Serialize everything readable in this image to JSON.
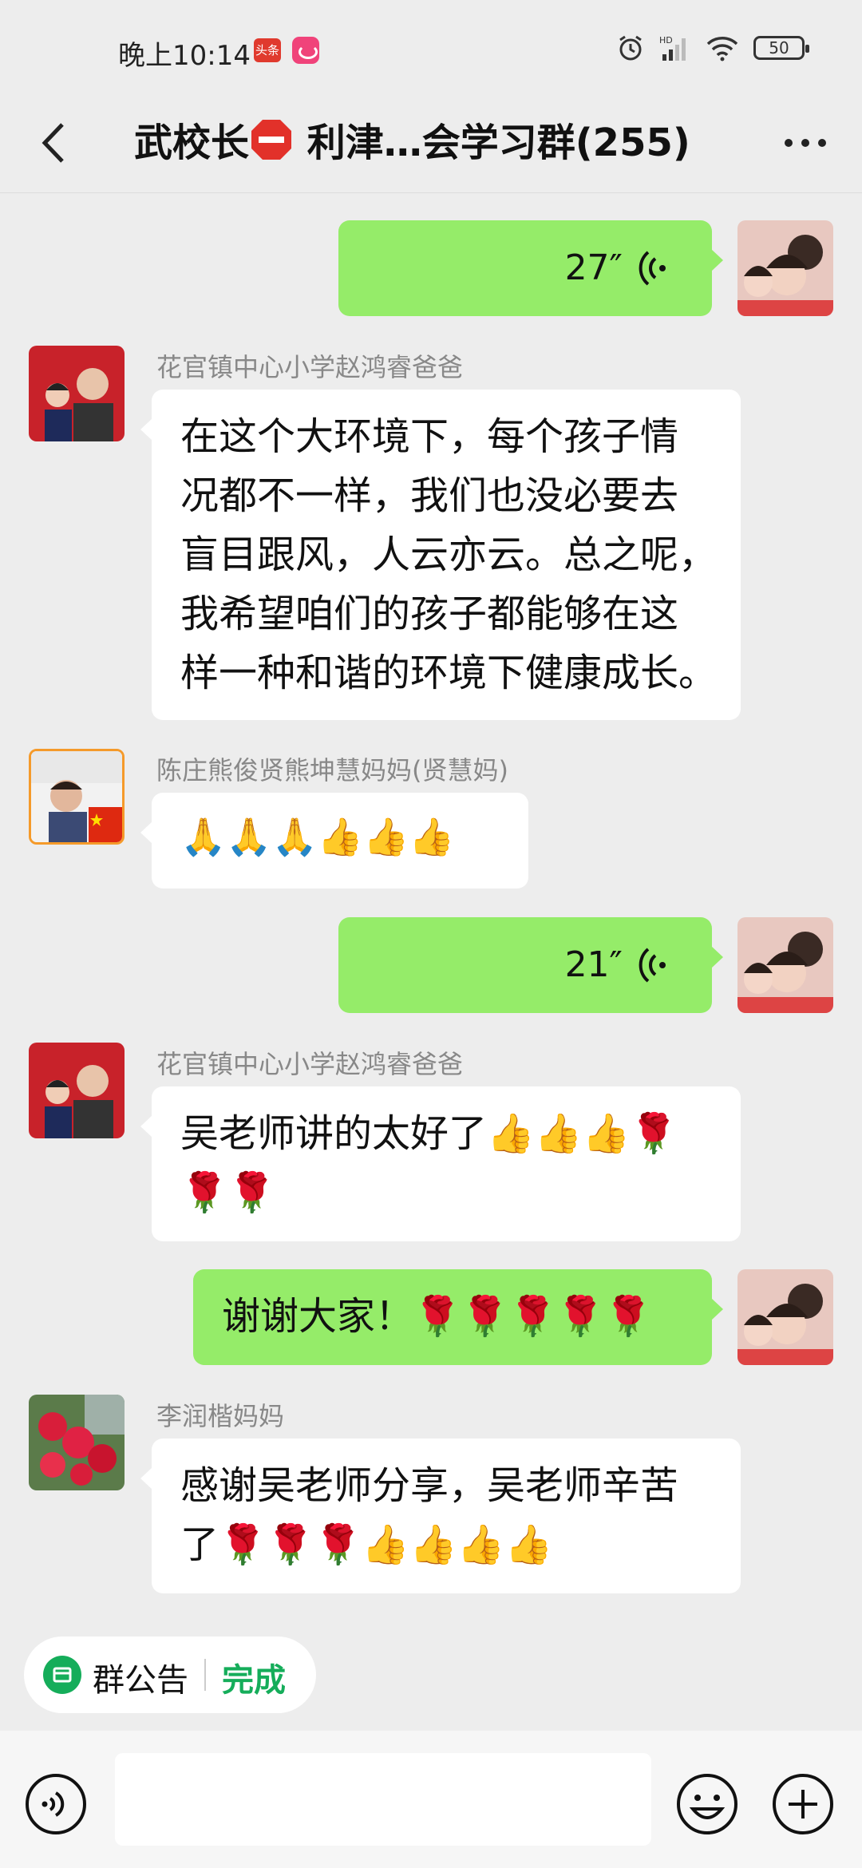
{
  "status_bar": {
    "time": "晚上10:14",
    "app1_label": "头条",
    "battery": "50"
  },
  "header": {
    "title_part1": "武校长",
    "title_part2": " 利津…会学习群(255)"
  },
  "messages": [
    {
      "type": "voice",
      "side": "right",
      "duration": "27″"
    },
    {
      "type": "text",
      "side": "left",
      "sender": "花官镇中心小学赵鸿睿爸爸",
      "lines": [
        "在这个大环境下，每个孩子情",
        "况都不一样，我们也没必要去",
        "盲目跟风，人云亦云。总之呢，",
        "我希望咱们的孩子都能够在这",
        "样一种和谐的环境下健康成长。"
      ]
    },
    {
      "type": "emoji",
      "side": "left",
      "sender": "陈庄熊俊贤熊坤慧妈妈(贤慧妈)",
      "text": "🙏🙏🙏👍👍👍"
    },
    {
      "type": "voice",
      "side": "right",
      "duration": "21″"
    },
    {
      "type": "text",
      "side": "left",
      "sender": "花官镇中心小学赵鸿睿爸爸",
      "lines": [
        "吴老师讲的太好了👍👍👍🌹",
        "🌹🌹"
      ]
    },
    {
      "type": "text",
      "side": "right",
      "text": "谢谢大家！🌹🌹🌹🌹🌹"
    },
    {
      "type": "text",
      "side": "left",
      "sender": "李润楷妈妈",
      "lines": [
        "感谢吴老师分享，吴老师辛苦",
        "了🌹🌹🌹👍👍👍👍"
      ]
    }
  ],
  "bottom": {
    "announcement_label": "群公告",
    "done_label": "完成"
  },
  "colors": {
    "green_bubble": "#95ec69",
    "accent_green": "#15ad5a",
    "background": "#ededed"
  },
  "icons": [
    "back-icon",
    "more-icon",
    "voice-wave-icon",
    "voice-input-icon",
    "emoji-icon",
    "plus-icon",
    "announcement-icon"
  ]
}
